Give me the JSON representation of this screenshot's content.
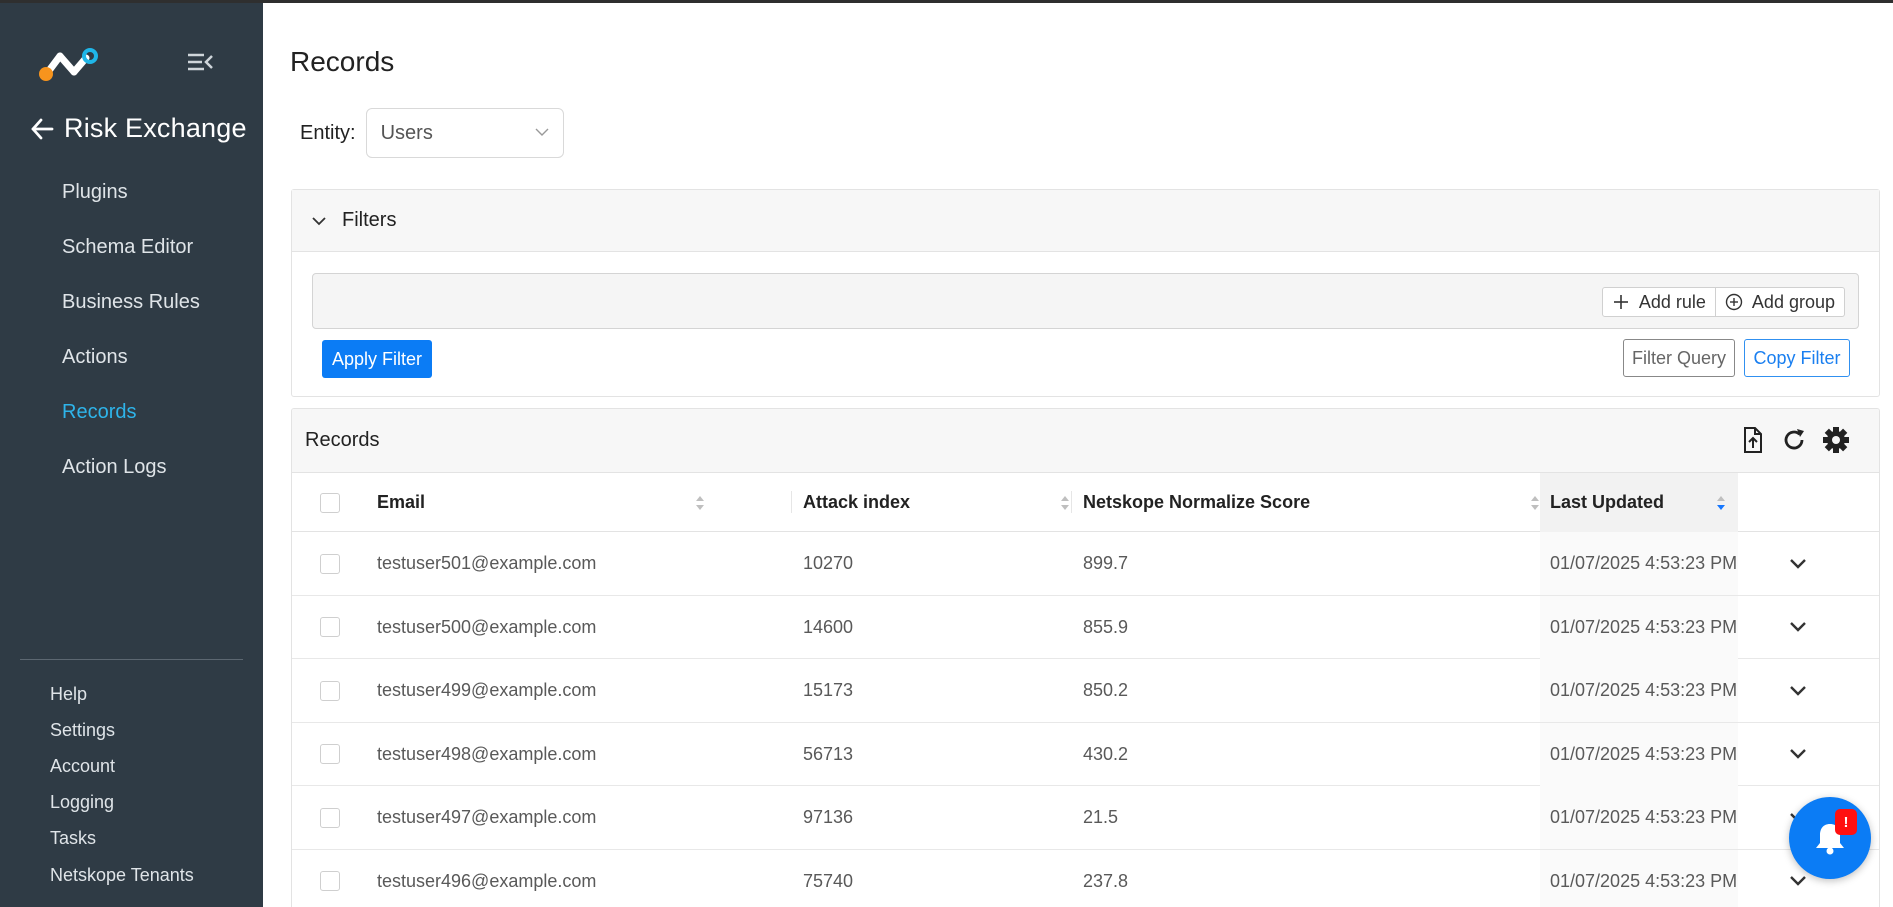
{
  "sidebar": {
    "section_title": "Risk Exchange",
    "nav_items": [
      {
        "label": "Plugins",
        "active": false
      },
      {
        "label": "Schema Editor",
        "active": false
      },
      {
        "label": "Business Rules",
        "active": false
      },
      {
        "label": "Actions",
        "active": false
      },
      {
        "label": "Records",
        "active": true
      },
      {
        "label": "Action Logs",
        "active": false
      }
    ],
    "bottom_items": [
      {
        "label": "Help"
      },
      {
        "label": "Settings"
      },
      {
        "label": "Account"
      },
      {
        "label": "Logging"
      },
      {
        "label": "Tasks"
      },
      {
        "label": "Netskope Tenants"
      }
    ]
  },
  "page": {
    "title": "Records",
    "entity_label": "Entity",
    "entity_value": "Users"
  },
  "filters": {
    "title": "Filters",
    "add_rule_label": "Add rule",
    "add_group_label": "Add group",
    "apply_label": "Apply Filter",
    "filter_query_label": "Filter Query",
    "copy_filter_label": "Copy Filter"
  },
  "records": {
    "title": "Records",
    "header_icons": [
      "export-icon",
      "refresh-icon",
      "settings-gear-icon"
    ],
    "columns": [
      "Email",
      "Attack index",
      "Netskope Normalize Score",
      "Last Updated"
    ],
    "rows": [
      {
        "email": "testuser501@example.com",
        "attack_index": "10270",
        "score": "899.7",
        "updated": "01/07/2025 4:53:23 PM"
      },
      {
        "email": "testuser500@example.com",
        "attack_index": "14600",
        "score": "855.9",
        "updated": "01/07/2025 4:53:23 PM"
      },
      {
        "email": "testuser499@example.com",
        "attack_index": "15173",
        "score": "850.2",
        "updated": "01/07/2025 4:53:23 PM"
      },
      {
        "email": "testuser498@example.com",
        "attack_index": "56713",
        "score": "430.2",
        "updated": "01/07/2025 4:53:23 PM"
      },
      {
        "email": "testuser497@example.com",
        "attack_index": "97136",
        "score": "21.5",
        "updated": "01/07/2025 4:53:23 PM"
      },
      {
        "email": "testuser496@example.com",
        "attack_index": "75740",
        "score": "237.8",
        "updated": "01/07/2025 4:53:23 PM"
      }
    ]
  },
  "notification": {
    "badge": "!"
  },
  "colors": {
    "sidebar_bg": "#2f3b45",
    "active_nav": "#2eb4ea",
    "primary": "#0b7cf5",
    "badge": "#ff1010"
  }
}
